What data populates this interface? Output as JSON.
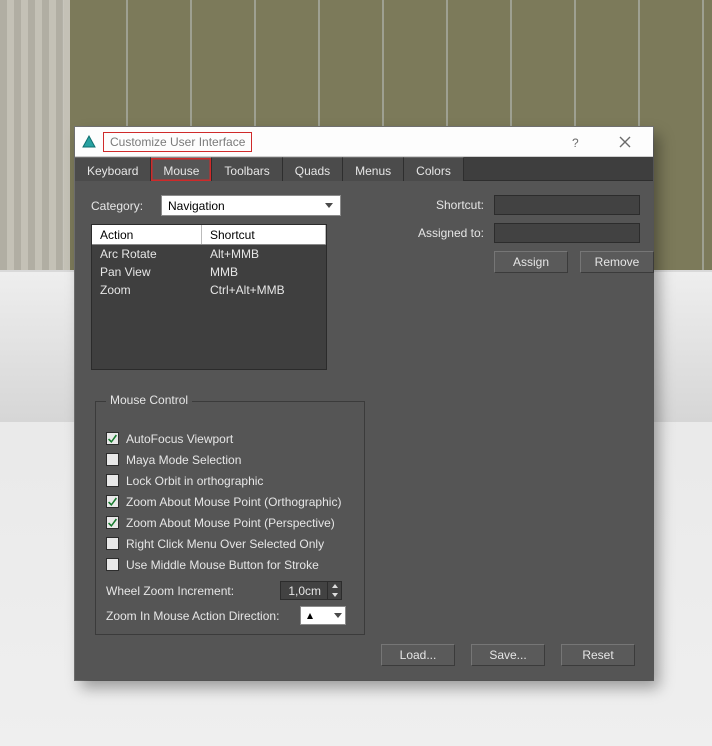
{
  "window": {
    "title": "Customize User Interface"
  },
  "tabs": [
    "Keyboard",
    "Mouse",
    "Toolbars",
    "Quads",
    "Menus",
    "Colors"
  ],
  "active_tab_index": 1,
  "category": {
    "label": "Category:",
    "value": "Navigation"
  },
  "columns": {
    "action": "Action",
    "shortcut": "Shortcut"
  },
  "rows": [
    {
      "action": "Arc Rotate",
      "shortcut": "Alt+MMB"
    },
    {
      "action": "Pan View",
      "shortcut": "MMB"
    },
    {
      "action": "Zoom",
      "shortcut": "Ctrl+Alt+MMB"
    }
  ],
  "shortcut_panel": {
    "shortcut_label": "Shortcut:",
    "assigned_label": "Assigned to:",
    "shortcut_value": "",
    "assigned_value": "",
    "assign": "Assign",
    "remove": "Remove"
  },
  "mouse_control": {
    "legend": "Mouse Control",
    "options": [
      {
        "label": "AutoFocus Viewport",
        "checked": true
      },
      {
        "label": "Maya Mode Selection",
        "checked": false
      },
      {
        "label": "Lock Orbit in orthographic",
        "checked": false
      },
      {
        "label": "Zoom About Mouse Point (Orthographic)",
        "checked": true
      },
      {
        "label": "Zoom About Mouse Point (Perspective)",
        "checked": true
      },
      {
        "label": "Right Click Menu Over Selected Only",
        "checked": false
      },
      {
        "label": "Use Middle Mouse Button for Stroke",
        "checked": false
      }
    ],
    "wheel_label": "Wheel Zoom Increment:",
    "wheel_value": "1,0cm",
    "direction_label": "Zoom In Mouse Action Direction:",
    "direction_value": "↑"
  },
  "footer": {
    "load": "Load...",
    "save": "Save...",
    "reset": "Reset"
  }
}
